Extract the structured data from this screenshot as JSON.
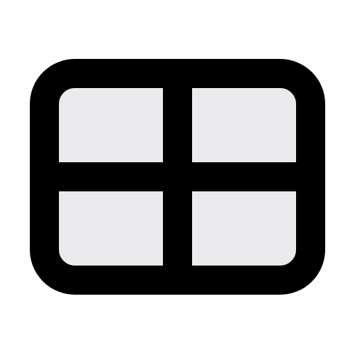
{
  "icon": {
    "name": "grid-four-panes-icon",
    "stroke_color": "#000000",
    "fill_color": "#eaeaec",
    "background_color": "#ffffff"
  }
}
